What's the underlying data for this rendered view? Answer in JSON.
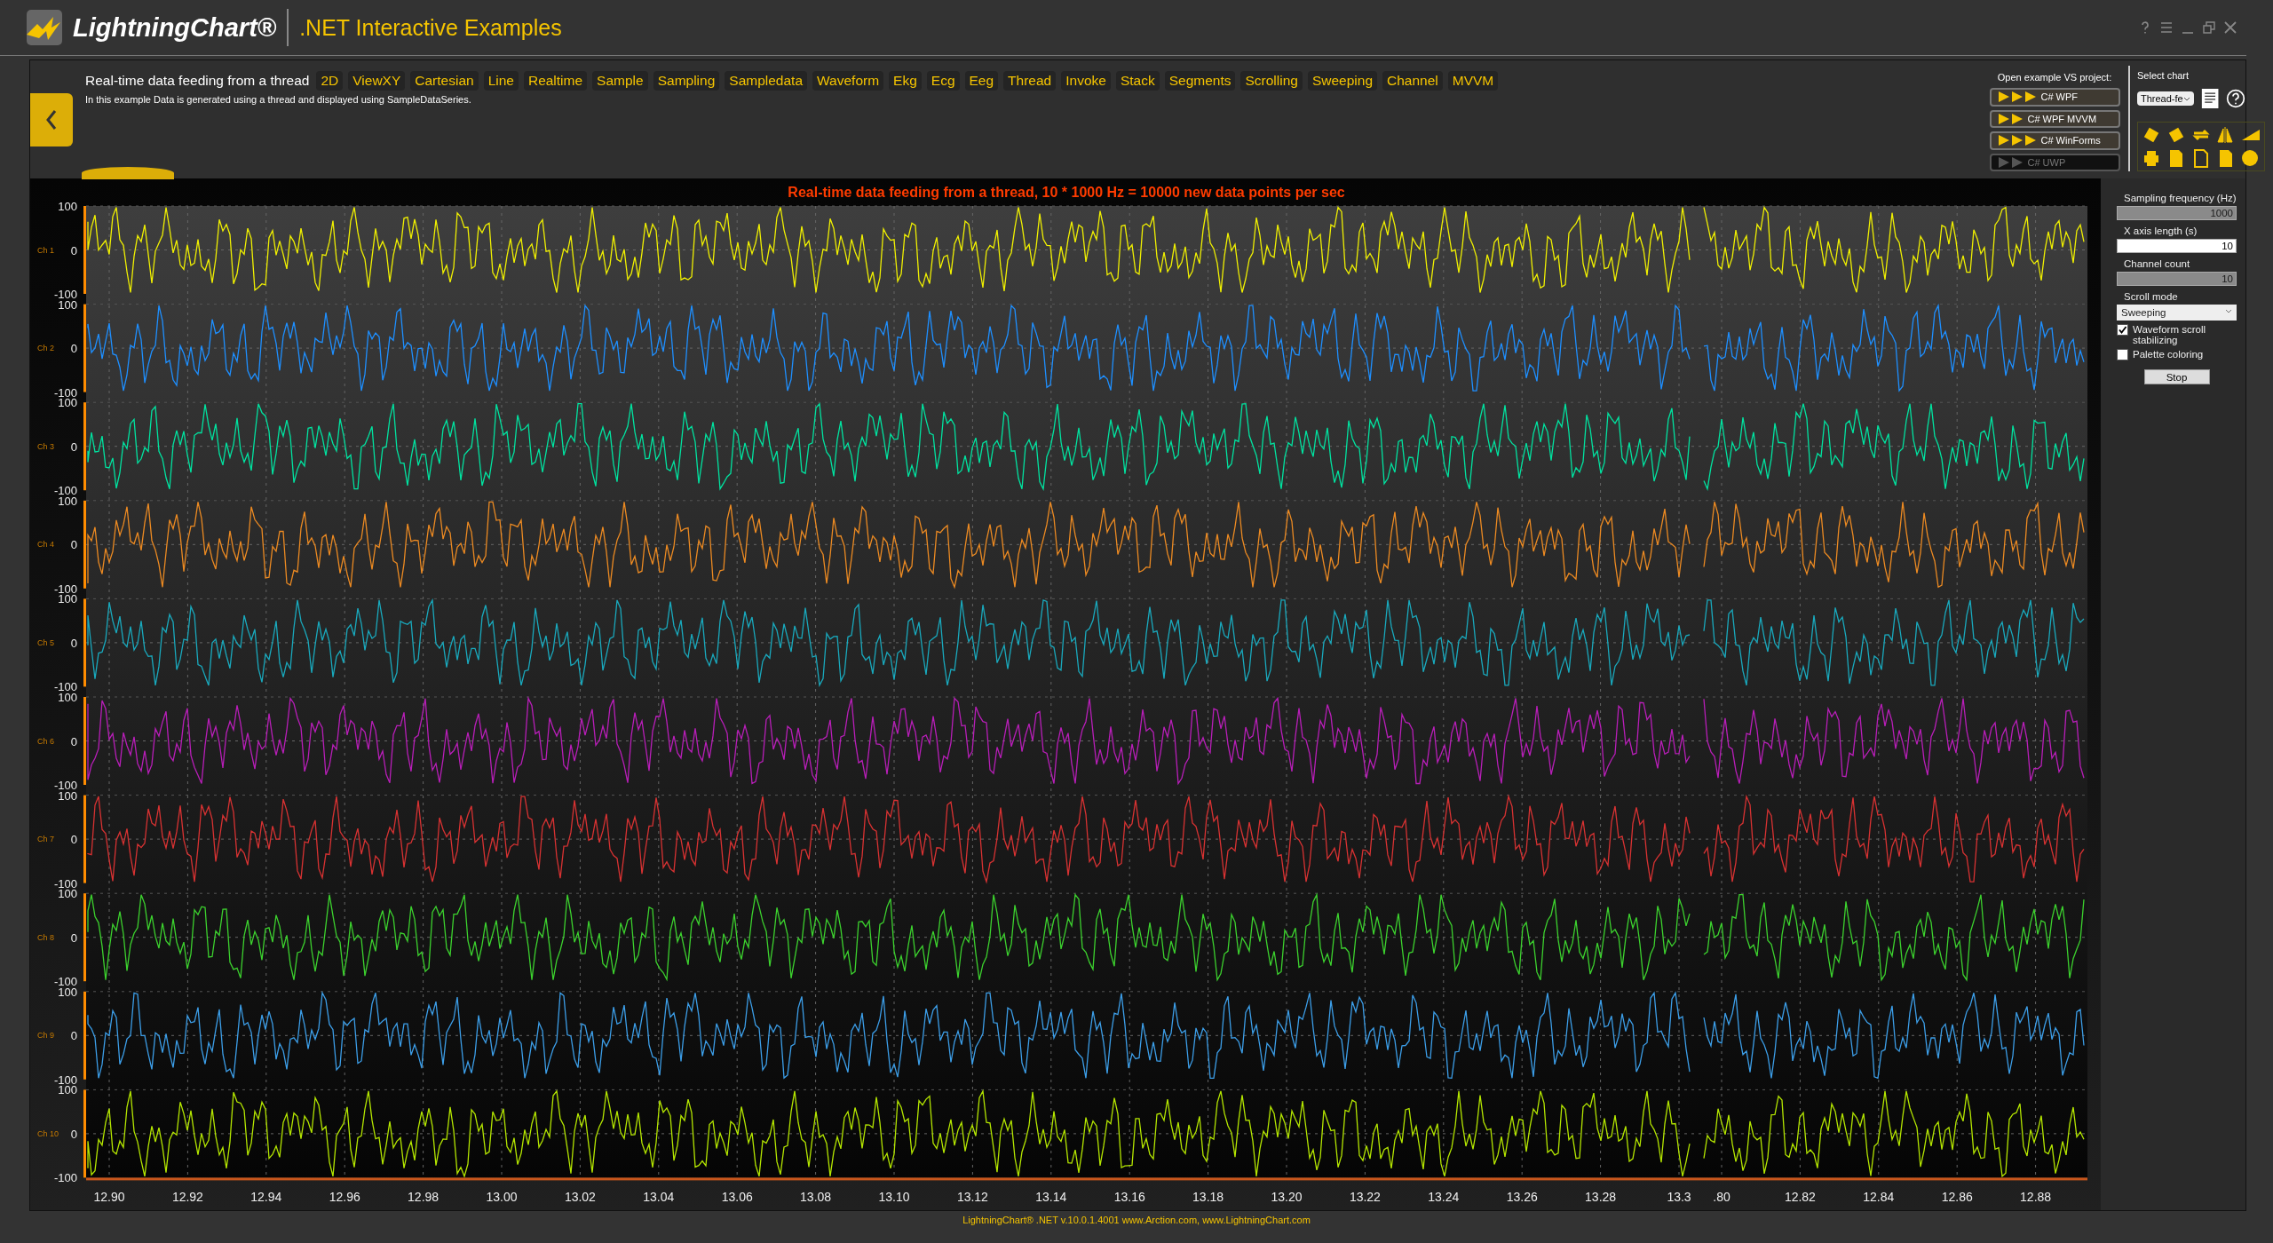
{
  "header": {
    "logo": "LightningChart®",
    "title": ".NET Interactive Examples"
  },
  "example": {
    "title": "Real-time data feeding from a thread",
    "description": "In this example Data is generated using a thread and displayed using SampleDataSeries.",
    "tags": [
      "2D",
      "ViewXY",
      "Cartesian",
      "Line",
      "Realtime",
      "Sample",
      "Sampling",
      "Sampledata",
      "Waveform",
      "Ekg",
      "Ecg",
      "Eeg",
      "Thread",
      "Invoke",
      "Stack",
      "Segments",
      "Scrolling",
      "Sweeping",
      "Channel",
      "MVVM"
    ]
  },
  "projects": {
    "label": "Open example VS project:",
    "buttons": [
      {
        "label": "C# WPF",
        "kind": "three-arrows",
        "disabled": false
      },
      {
        "label": "C# WPF MVVM",
        "kind": "two-arrows",
        "disabled": false
      },
      {
        "label": "C# WinForms",
        "kind": "three-arrows",
        "disabled": false
      },
      {
        "label": "C# UWP",
        "kind": "two-arrows",
        "disabled": true
      }
    ]
  },
  "select_chart": {
    "label": "Select chart",
    "value": "Thread-fe"
  },
  "chart": {
    "title": "Real-time data feeding from a thread, 10 * 1000 Hz = 10000 new data points per sec",
    "channels": [
      {
        "name": "Ch 1",
        "color": "#f0f000",
        "y_ticks": [
          "100",
          "0",
          "-100"
        ]
      },
      {
        "name": "Ch 2",
        "color": "#1e8fff",
        "y_ticks": [
          "100",
          "0",
          "-100"
        ]
      },
      {
        "name": "Ch 3",
        "color": "#00e3a0",
        "y_ticks": [
          "100",
          "0",
          "-100"
        ]
      },
      {
        "name": "Ch 4",
        "color": "#ec8a22",
        "y_ticks": [
          "100",
          "0",
          "-100"
        ]
      },
      {
        "name": "Ch 5",
        "color": "#19a9bd",
        "y_ticks": [
          "100",
          "0",
          "-100"
        ]
      },
      {
        "name": "Ch 6",
        "color": "#b81eb8",
        "y_ticks": [
          "100",
          "0",
          "-100"
        ]
      },
      {
        "name": "Ch 7",
        "color": "#d83232",
        "y_ticks": [
          "100",
          "0",
          "-100"
        ]
      },
      {
        "name": "Ch 8",
        "color": "#3cd22e",
        "y_ticks": [
          "100",
          "0",
          "-100"
        ]
      },
      {
        "name": "Ch 9",
        "color": "#3c9ee8",
        "y_ticks": [
          "100",
          "0",
          "-100"
        ]
      },
      {
        "name": "Ch 10",
        "color": "#b4e600",
        "y_ticks": [
          "100",
          "0",
          "-100"
        ]
      }
    ],
    "x_ticks": [
      "12.90",
      "12.92",
      "12.94",
      "12.96",
      "12.98",
      "13.00",
      "13.02",
      "13.04",
      "13.06",
      "13.08",
      "13.10",
      "13.12",
      "13.14",
      "13.16",
      "13.18",
      "13.20",
      "13.22",
      "13.24",
      "13.26",
      "13.28",
      "13.3",
      ".80",
      "12.82",
      "12.84",
      "12.86",
      "12.88"
    ]
  },
  "settings": {
    "fields": [
      {
        "label": "Sampling frequency (Hz)",
        "value": "1000",
        "disabled": true
      },
      {
        "label": "X axis length (s)",
        "value": "10",
        "disabled": false
      },
      {
        "label": "Channel count",
        "value": "10",
        "disabled": true
      }
    ],
    "scroll_mode": {
      "label": "Scroll mode",
      "value": "Sweeping"
    },
    "checkboxes": [
      {
        "label": "Waveform scroll stabilizing",
        "checked": true
      },
      {
        "label": "Palette coloring",
        "checked": false
      }
    ],
    "button": "Stop"
  },
  "footer": "LightningChart® .NET v.10.0.1.4001  www.Arction.com, www.LightningChart.com"
}
